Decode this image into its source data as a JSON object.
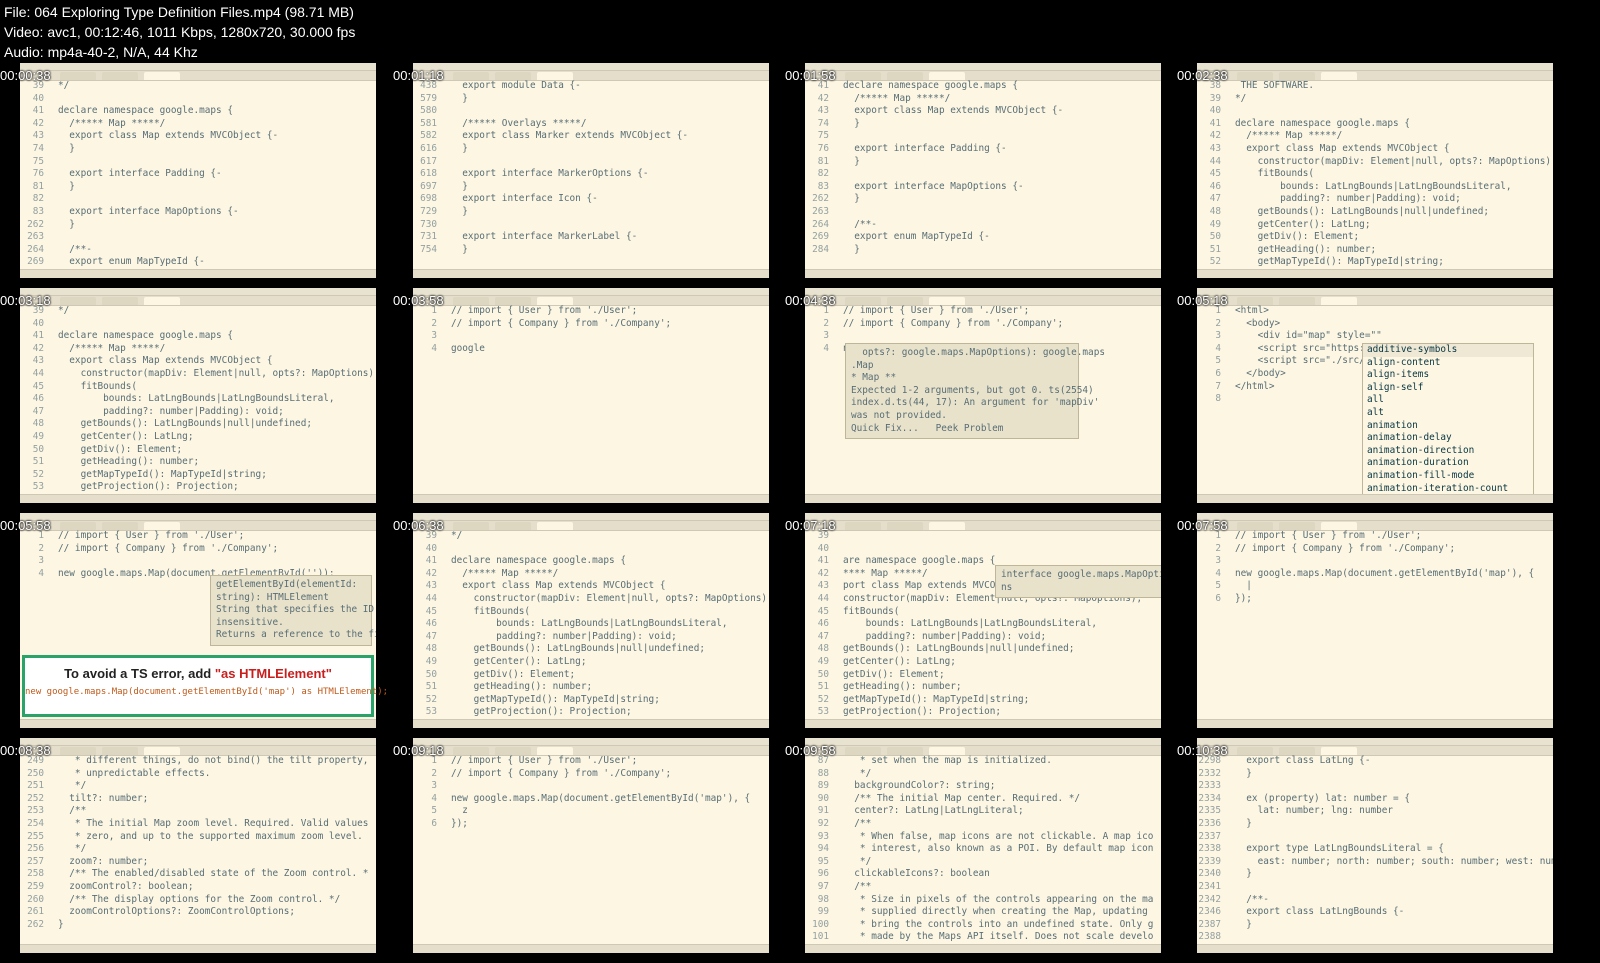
{
  "header": {
    "file_line": "File: 064 Exploring Type Definition Files.mp4 (98.71 MB)",
    "video_line": "Video: avc1, 00:12:46, 1011 Kbps, 1280x720, 30.000 fps",
    "audio_line": "Audio: mp4a-40-2, N/A, 44 Khz"
  },
  "tiles": [
    {
      "timestamp": "00:00:38",
      "lines": [
        [
          "39",
          "*/"
        ],
        [
          "40",
          ""
        ],
        [
          "41",
          "declare namespace google.maps {"
        ],
        [
          "42",
          "  /***** Map *****/"
        ],
        [
          "43",
          "  export class Map extends MVCObject {-"
        ],
        [
          "74",
          "  }"
        ],
        [
          "75",
          ""
        ],
        [
          "76",
          "  export interface Padding {-"
        ],
        [
          "81",
          "  }"
        ],
        [
          "82",
          ""
        ],
        [
          "83",
          "  export interface MapOptions {-"
        ],
        [
          "262",
          "  }"
        ],
        [
          "263",
          ""
        ],
        [
          "264",
          "  /**-"
        ],
        [
          "269",
          "  export enum MapTypeId {-"
        ]
      ]
    },
    {
      "timestamp": "00:01:18",
      "lines": [
        [
          "438",
          "  export module Data {-"
        ],
        [
          "579",
          "  }"
        ],
        [
          "580",
          ""
        ],
        [
          "581",
          "  /***** Overlays *****/"
        ],
        [
          "582",
          "  export class Marker extends MVCObject {-"
        ],
        [
          "616",
          "  }"
        ],
        [
          "617",
          ""
        ],
        [
          "618",
          "  export interface MarkerOptions {-"
        ],
        [
          "697",
          "  }"
        ],
        [
          "698",
          "  export interface Icon {-"
        ],
        [
          "729",
          "  }"
        ],
        [
          "730",
          ""
        ],
        [
          "731",
          "  export interface MarkerLabel {-"
        ],
        [
          "754",
          "  }"
        ]
      ]
    },
    {
      "timestamp": "00:01:58",
      "lines": [
        [
          "41",
          "declare namespace google.maps {"
        ],
        [
          "42",
          "  /***** Map *****/"
        ],
        [
          "43",
          "  export class Map extends MVCObject {-"
        ],
        [
          "74",
          "  }"
        ],
        [
          "75",
          ""
        ],
        [
          "76",
          "  export interface Padding {-"
        ],
        [
          "81",
          "  }"
        ],
        [
          "82",
          ""
        ],
        [
          "83",
          "  export interface MapOptions {-"
        ],
        [
          "262",
          "  }"
        ],
        [
          "263",
          ""
        ],
        [
          "264",
          "  /**-"
        ],
        [
          "269",
          "  export enum MapTypeId {-"
        ],
        [
          "284",
          "  }"
        ]
      ]
    },
    {
      "timestamp": "00:02:38",
      "lines": [
        [
          "38",
          " THE SOFTWARE."
        ],
        [
          "39",
          "*/"
        ],
        [
          "40",
          ""
        ],
        [
          "41",
          "declare namespace google.maps {"
        ],
        [
          "42",
          "  /***** Map *****/"
        ],
        [
          "43",
          "  export class Map extends MVCObject {"
        ],
        [
          "44",
          "    constructor(mapDiv: Element|null, opts?: MapOptions);"
        ],
        [
          "45",
          "    fitBounds("
        ],
        [
          "46",
          "        bounds: LatLngBounds|LatLngBoundsLiteral,"
        ],
        [
          "47",
          "        padding?: number|Padding): void;"
        ],
        [
          "48",
          "    getBounds(): LatLngBounds|null|undefined;"
        ],
        [
          "49",
          "    getCenter(): LatLng;"
        ],
        [
          "50",
          "    getDiv(): Element;"
        ],
        [
          "51",
          "    getHeading(): number;"
        ],
        [
          "52",
          "    getMapTypeId(): MapTypeId|string;"
        ]
      ]
    },
    {
      "timestamp": "00:03:18",
      "lines": [
        [
          "39",
          "*/"
        ],
        [
          "40",
          ""
        ],
        [
          "41",
          "declare namespace google.maps {"
        ],
        [
          "42",
          "  /***** Map *****/"
        ],
        [
          "43",
          "  export class Map extends MVCObject {"
        ],
        [
          "44",
          "    constructor(mapDiv: Element|null, opts?: MapOptions);"
        ],
        [
          "45",
          "    fitBounds("
        ],
        [
          "46",
          "        bounds: LatLngBounds|LatLngBoundsLiteral,"
        ],
        [
          "47",
          "        padding?: number|Padding): void;"
        ],
        [
          "48",
          "    getBounds(): LatLngBounds|null|undefined;"
        ],
        [
          "49",
          "    getCenter(): LatLng;"
        ],
        [
          "50",
          "    getDiv(): Element;"
        ],
        [
          "51",
          "    getHeading(): number;"
        ],
        [
          "52",
          "    getMapTypeId(): MapTypeId|string;"
        ],
        [
          "53",
          "    getProjection(): Projection;"
        ]
      ]
    },
    {
      "timestamp": "00:03:58",
      "lines": [
        [
          "1",
          "// import { User } from './User';"
        ],
        [
          "2",
          "// import { Company } from './Company';"
        ],
        [
          "3",
          ""
        ],
        [
          "4",
          "google"
        ]
      ]
    },
    {
      "timestamp": "00:04:38",
      "lines": [
        [
          "1",
          "// import { User } from './User';"
        ],
        [
          "2",
          "// import { Company } from './Company';"
        ],
        [
          "3",
          ""
        ],
        [
          "4",
          "new google.maps.Map();"
        ]
      ],
      "popup": "  opts?: google.maps.MapOptions): google.maps\n.Map\n* Map **\nExpected 1-2 arguments, but got 0. ts(2554)\nindex.d.ts(44, 17): An argument for 'mapDiv'\nwas not provided.\nQuick Fix...   Peek Problem"
    },
    {
      "timestamp": "00:05:18",
      "lines": [
        [
          "1",
          "<html>"
        ],
        [
          "2",
          "  <body>"
        ],
        [
          "3",
          "    <div id=\"map\" style=\"\""
        ],
        [
          "4",
          "    <script src=\"https://"
        ],
        [
          "5",
          "    <script src=\"./src/in"
        ],
        [
          "6",
          "  </body>"
        ],
        [
          "7",
          "</html>"
        ],
        [
          "8",
          ""
        ]
      ],
      "suggestions": [
        "additive-symbols",
        "align-content",
        "align-items",
        "align-self",
        "all",
        "alt",
        "animation",
        "animation-delay",
        "animation-direction",
        "animation-duration",
        "animation-fill-mode",
        "animation-iteration-count"
      ]
    },
    {
      "timestamp": "00:05:58",
      "lines": [
        [
          "1",
          "// import { User } from './User';"
        ],
        [
          "2",
          "// import { Company } from './Company';"
        ],
        [
          "3",
          ""
        ],
        [
          "4",
          "new google.maps.Map(document.getElementById(''));"
        ]
      ],
      "popup": "getElementById(elementId:\nstring): HTMLElement\nString that specifies the ID value. Case-\ninsensitive.\nReturns a reference to the first object with"
    },
    {
      "timestamp": "00:06:38",
      "lines": [
        [
          "39",
          "*/"
        ],
        [
          "40",
          ""
        ],
        [
          "41",
          "declare namespace google.maps {"
        ],
        [
          "42",
          "  /***** Map *****/"
        ],
        [
          "43",
          "  export class Map extends MVCObject {"
        ],
        [
          "44",
          "    constructor(mapDiv: Element|null, opts?: MapOptions);"
        ],
        [
          "45",
          "    fitBounds("
        ],
        [
          "46",
          "        bounds: LatLngBounds|LatLngBoundsLiteral,"
        ],
        [
          "47",
          "        padding?: number|Padding): void;"
        ],
        [
          "48",
          "    getBounds(): LatLngBounds|null|undefined;"
        ],
        [
          "49",
          "    getCenter(): LatLng;"
        ],
        [
          "50",
          "    getDiv(): Element;"
        ],
        [
          "51",
          "    getHeading(): number;"
        ],
        [
          "52",
          "    getMapTypeId(): MapTypeId|string;"
        ],
        [
          "53",
          "    getProjection(): Projection;"
        ]
      ]
    },
    {
      "timestamp": "00:07:18",
      "lines": [
        [
          "39",
          ""
        ],
        [
          "40",
          ""
        ],
        [
          "41",
          "are namespace google.maps {"
        ],
        [
          "42",
          "**** Map *****/"
        ],
        [
          "43",
          "port class Map extends MVCObj"
        ],
        [
          "44",
          "constructor(mapDiv: Element|null, opts?: MapOptions);"
        ],
        [
          "45",
          "fitBounds("
        ],
        [
          "46",
          "    bounds: LatLngBounds|LatLngBoundsLiteral,"
        ],
        [
          "47",
          "    padding?: number|Padding): void;"
        ],
        [
          "48",
          "getBounds(): LatLngBounds|null|undefined;"
        ],
        [
          "49",
          "getCenter(): LatLng;"
        ],
        [
          "50",
          "getDiv(): Element;"
        ],
        [
          "51",
          "getHeading(): number;"
        ],
        [
          "52",
          "getMapTypeId(): MapTypeId|string;"
        ],
        [
          "53",
          "getProjection(): Projection;"
        ]
      ],
      "popup": "interface google.maps.MapOptio\nns"
    },
    {
      "timestamp": "00:07:58",
      "lines": [
        [
          "1",
          "// import { User } from './User';"
        ],
        [
          "2",
          "// import { Company } from './Company';"
        ],
        [
          "3",
          ""
        ],
        [
          "4",
          "new google.maps.Map(document.getElementById('map'), {"
        ],
        [
          "5",
          "  |"
        ],
        [
          "6",
          "});"
        ]
      ]
    },
    {
      "timestamp": "00:08:38",
      "lines": [
        [
          "249",
          "   * different things, do not bind() the tilt property,"
        ],
        [
          "250",
          "   * unpredictable effects."
        ],
        [
          "251",
          "   */"
        ],
        [
          "252",
          "  tilt?: number;"
        ],
        [
          "253",
          "  /**"
        ],
        [
          "254",
          "   * The initial Map zoom level. Required. Valid values"
        ],
        [
          "255",
          "   * zero, and up to the supported maximum zoom level."
        ],
        [
          "256",
          "   */"
        ],
        [
          "257",
          "  zoom?: number;"
        ],
        [
          "258",
          "  /** The enabled/disabled state of the Zoom control. *"
        ],
        [
          "259",
          "  zoomControl?: boolean;"
        ],
        [
          "260",
          "  /** The display options for the Zoom control. */"
        ],
        [
          "261",
          "  zoomControlOptions?: ZoomControlOptions;"
        ],
        [
          "262",
          "}"
        ]
      ]
    },
    {
      "timestamp": "00:09:18",
      "lines": [
        [
          "1",
          "// import { User } from './User';"
        ],
        [
          "2",
          "// import { Company } from './Company';"
        ],
        [
          "3",
          ""
        ],
        [
          "4",
          "new google.maps.Map(document.getElementById('map'), {"
        ],
        [
          "5",
          "  z"
        ],
        [
          "6",
          "});"
        ]
      ]
    },
    {
      "timestamp": "00:09:58",
      "lines": [
        [
          "87",
          "   * set when the map is initialized."
        ],
        [
          "88",
          "   */"
        ],
        [
          "89",
          "  backgroundColor?: string;"
        ],
        [
          "90",
          "  /** The initial Map center. Required. */"
        ],
        [
          "91",
          "  center?: LatLng|LatLngLiteral;"
        ],
        [
          "92",
          "  /**"
        ],
        [
          "93",
          "   * When false, map icons are not clickable. A map ico"
        ],
        [
          "94",
          "   * interest, also known as a POI. By default map icon"
        ],
        [
          "95",
          "   */"
        ],
        [
          "96",
          "  clickableIcons?: boolean"
        ],
        [
          "97",
          "  /**"
        ],
        [
          "98",
          "   * Size in pixels of the controls appearing on the ma"
        ],
        [
          "99",
          "   * supplied directly when creating the Map, updating"
        ],
        [
          "100",
          "   * bring the controls into an undefined state. Only g"
        ],
        [
          "101",
          "   * made by the Maps API itself. Does not scale develo"
        ]
      ]
    },
    {
      "timestamp": "00:10:38",
      "lines": [
        [
          "2298",
          "  export class LatLng {-"
        ],
        [
          "2332",
          "  }"
        ],
        [
          "2333",
          ""
        ],
        [
          "2334",
          "  ex (property) lat: number = {"
        ],
        [
          "2335",
          "    lat: number; lng: number"
        ],
        [
          "2336",
          "  }"
        ],
        [
          "2337",
          ""
        ],
        [
          "2338",
          "  export type LatLngBoundsLiteral = {"
        ],
        [
          "2339",
          "    east: number; north: number; south: number; west: num"
        ],
        [
          "2340",
          "  }"
        ],
        [
          "2341",
          ""
        ],
        [
          "2342",
          "  /**-"
        ],
        [
          "2346",
          "  export class LatLngBounds {-"
        ],
        [
          "2387",
          "  }"
        ],
        [
          "2388",
          ""
        ]
      ]
    }
  ],
  "callout": {
    "title_prefix": "To avoid a TS error, add ",
    "title_highlight": "\"as HTMLElement\"",
    "code": "new google.maps.Map(document.getElementById('map') as HTMLElement);"
  },
  "colors": {
    "editor_bg": "#fdf6e3",
    "callout_border": "#2aa36b",
    "callout_red": "#c81e1e"
  }
}
